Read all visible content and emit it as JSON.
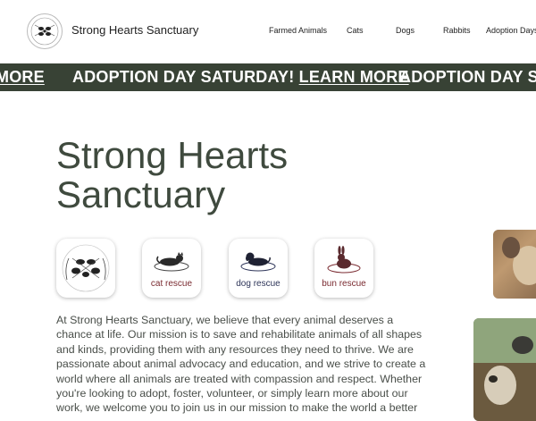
{
  "header": {
    "brand": "Strong Hearts Sanctuary",
    "nav": [
      {
        "label": "Farmed Animals"
      },
      {
        "label": "Cats"
      },
      {
        "label": "Dogs"
      },
      {
        "label": "Rabbits"
      },
      {
        "label": "Adoption Days"
      }
    ]
  },
  "banner": {
    "segments": [
      {
        "text": "",
        "link": "MORE"
      },
      {
        "text": "ADOPTION DAY SATURDAY! ",
        "link": "LEARN MORE"
      },
      {
        "text": "ADOPTION DAY SAT",
        "link": ""
      }
    ]
  },
  "hero": {
    "title": "Strong Hearts Sanctuary"
  },
  "badges": [
    {
      "name": "farm-sanctuary",
      "label": "",
      "color": "#222222"
    },
    {
      "name": "cat-rescue",
      "label": "cat rescue",
      "color": "#7a2a30"
    },
    {
      "name": "dog-rescue",
      "label": "dog rescue",
      "color": "#2e3559"
    },
    {
      "name": "bun-rescue",
      "label": "bun rescue",
      "color": "#7a2a30"
    }
  ],
  "intro": {
    "text": "At Strong Hearts Sanctuary, we believe that every animal deserves a chance at life. Our mission is to save and rehabilitate animals of all shapes and kinds, providing them with any resources they need to thrive. We are passionate about animal advocacy and education, and we strive to create a world where all animals are treated with compassion and respect. Whether you're looking to adopt, foster, volunteer, or simply learn more about our work, we welcome you to join us in our mission to make the world a better"
  },
  "colors": {
    "banner_bg": "#384235",
    "title": "#3f4a3e",
    "body_text": "#4a4f4a"
  }
}
